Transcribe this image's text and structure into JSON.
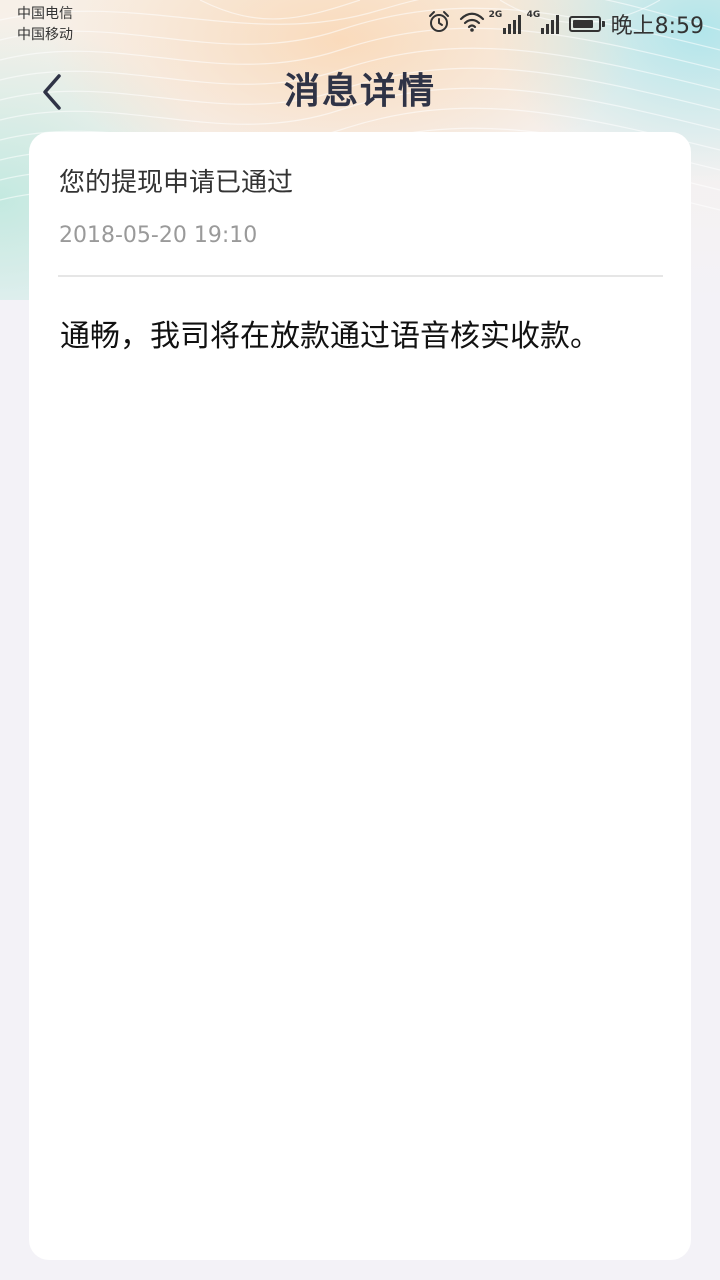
{
  "status_bar": {
    "carrier_1": "中国电信",
    "carrier_2": "中国移动",
    "net_1": "2G",
    "net_2": "4G",
    "time": "晚上8:59",
    "icons": [
      "alarm-icon",
      "wifi-icon",
      "signal-2g-icon",
      "signal-4g-icon",
      "battery-icon"
    ]
  },
  "header": {
    "title": "消息详情",
    "back_icon": "chevron-left-icon"
  },
  "message": {
    "title": "您的提现申请已通过",
    "time": "2018-05-20 19:10",
    "body": "通畅，我司将在放款通过语音核实收款。"
  },
  "colors": {
    "title": "#2f3346",
    "timestamp": "#9a9a9a",
    "page_background": "#f3f2f7",
    "card_background": "#ffffff"
  }
}
